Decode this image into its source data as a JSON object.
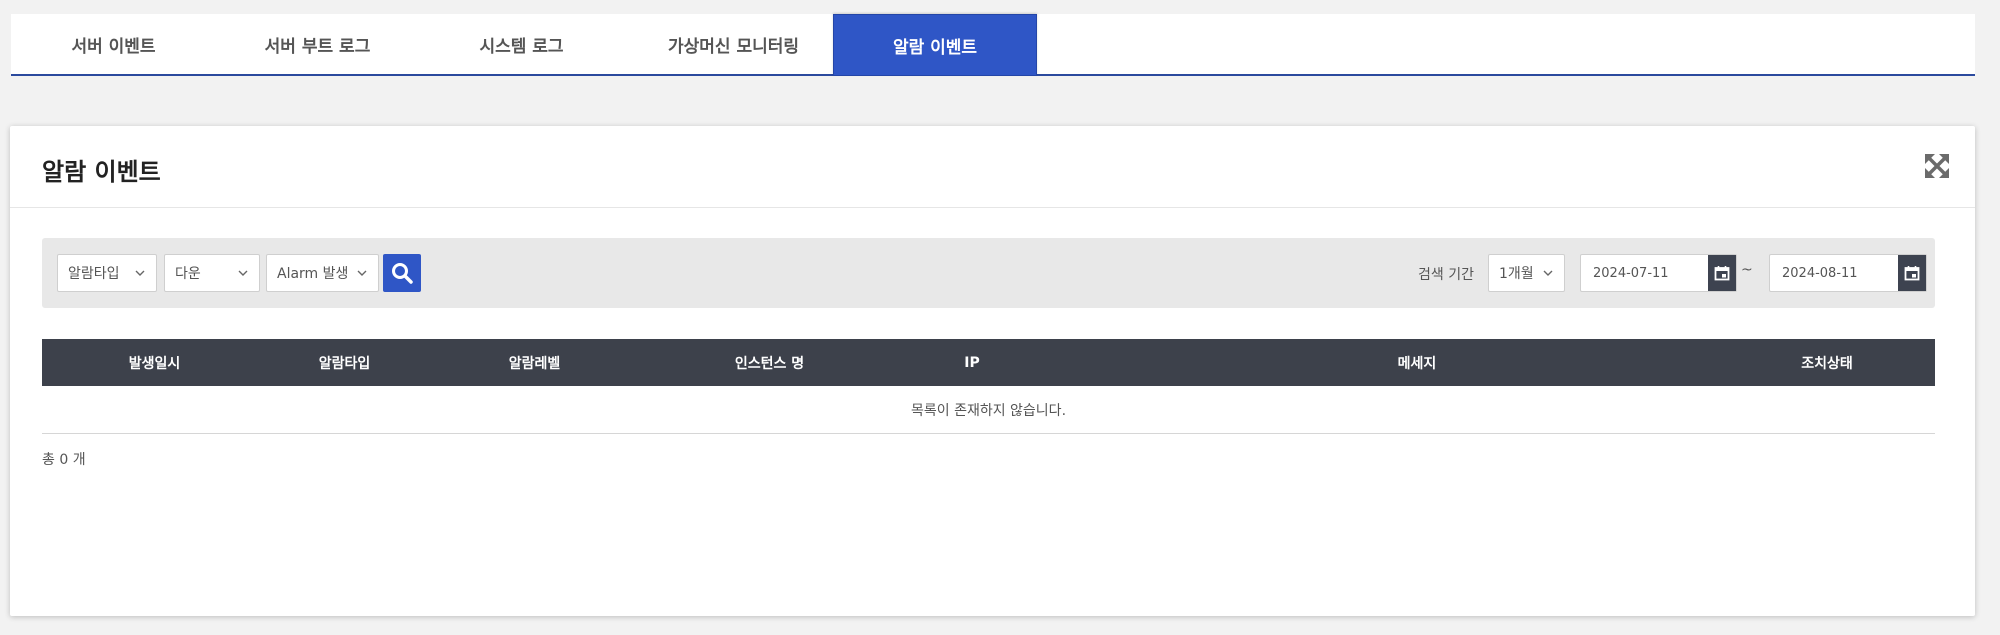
{
  "tabs": [
    {
      "label": "서버 이벤트",
      "active": false
    },
    {
      "label": "서버 부트 로그",
      "active": false
    },
    {
      "label": "시스템 로그",
      "active": false
    },
    {
      "label": "가상머신 모니터링",
      "active": false
    },
    {
      "label": "알람 이벤트",
      "active": true
    }
  ],
  "panel": {
    "title": "알람 이벤트",
    "expand_icon": "expand-arrows-icon"
  },
  "filters": {
    "alarm_type": "알람타입",
    "level": "다운",
    "event": "Alarm 발생",
    "search_icon": "search-icon",
    "period_label": "검색 기간",
    "period": "1개월",
    "date_from": "2024-07-11",
    "date_separator": "~",
    "date_to": "2024-08-11",
    "calendar_icon": "calendar-icon"
  },
  "table": {
    "columns": [
      "발생일시",
      "알람타입",
      "알람레벨",
      "인스턴스 명",
      "IP",
      "메세지",
      "조치상태"
    ],
    "empty_message": "목록이 존재하지 않습니다."
  },
  "footer": {
    "total": "총 0 개"
  },
  "colors": {
    "accent": "#2f56c6",
    "table_header": "#3d414b",
    "calendar_button": "#3d4350"
  }
}
